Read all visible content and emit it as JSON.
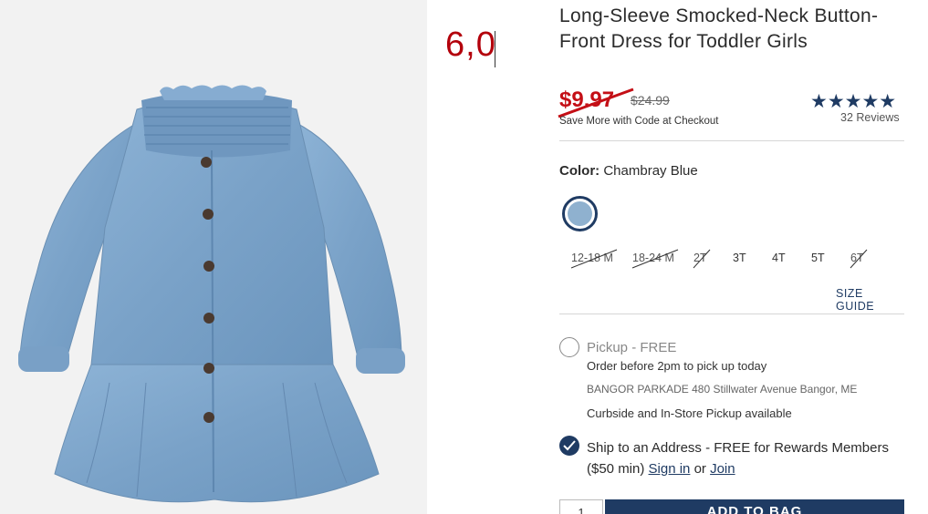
{
  "overlay": {
    "number": "6,0"
  },
  "product": {
    "title": "Long-Sleeve Smocked-Neck Button-Front Dress for Toddler Girls",
    "sale_price": "$9.97",
    "original_price": "$24.99",
    "promo": "Save More with Code at Checkout",
    "rating_stars": "★★★★★",
    "rating_value": 5,
    "reviews": "32 Reviews"
  },
  "color": {
    "label": "Color:",
    "value": "Chambray Blue",
    "swatch_color": "#8fb1cf"
  },
  "sizes": [
    {
      "label": "12-18 M",
      "available": false
    },
    {
      "label": "18-24 M",
      "available": false
    },
    {
      "label": "2T",
      "available": false
    },
    {
      "label": "3T",
      "available": true
    },
    {
      "label": "4T",
      "available": true
    },
    {
      "label": "5T",
      "available": true
    },
    {
      "label": "6T",
      "available": false
    }
  ],
  "size_guide": "SIZE GUIDE",
  "fulfillment": {
    "pickup_label": "Pickup - FREE",
    "pickup_note": "Order before 2pm to pick up today",
    "store": "BANGOR PARKADE 480 Stillwater Avenue  Bangor, ME",
    "curbside": "Curbside and In-Store Pickup available",
    "ship_label": "Ship to an Address - FREE for Rewards Members ($50 min)",
    "sign_in": "Sign in",
    "or": "or",
    "join": "Join"
  },
  "cart": {
    "qty": "1",
    "add_label": "ADD TO BAG"
  },
  "colors": {
    "brand_navy": "#1f3b63",
    "sale_red": "#c40f16",
    "overlay_red": "#b3000b"
  }
}
